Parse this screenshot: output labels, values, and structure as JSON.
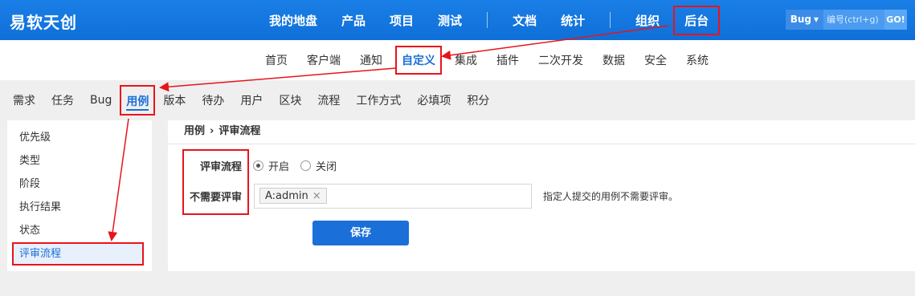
{
  "brand": "易软天创",
  "main_nav": {
    "items": [
      "我的地盘",
      "产品",
      "项目",
      "测试"
    ],
    "items2": [
      "文档",
      "统计"
    ],
    "items3": [
      "组织"
    ],
    "active": "后台"
  },
  "search": {
    "type": "Bug",
    "placeholder": "编号(ctrl+g)",
    "go": "GO!"
  },
  "sub_nav": [
    "首页",
    "客户端",
    "通知",
    "自定义",
    "集成",
    "插件",
    "二次开发",
    "数据",
    "安全",
    "系统"
  ],
  "third_nav": [
    "需求",
    "任务",
    "Bug",
    "用例",
    "版本",
    "待办",
    "用户",
    "区块",
    "流程",
    "工作方式",
    "必填项",
    "积分"
  ],
  "sidebar": [
    "优先级",
    "类型",
    "阶段",
    "执行结果",
    "状态",
    "评审流程"
  ],
  "breadcrumb": {
    "parent": "用例",
    "arrow": "›",
    "current": "评审流程"
  },
  "form": {
    "review_label": "评审流程",
    "option_on": "开启",
    "option_off": "关闭",
    "noreview_label": "不需要评审",
    "chip": "A:admin",
    "chip_remove": "×",
    "hint": "指定人提交的用例不需要评审。",
    "save": "保存"
  },
  "colors": {
    "primary": "#1a6fd8",
    "highlight": "#e8141b"
  }
}
